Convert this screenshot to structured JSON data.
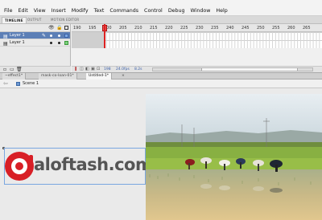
{
  "menu": [
    "File",
    "Edit",
    "View",
    "Insert",
    "Modify",
    "Text",
    "Commands",
    "Control",
    "Debug",
    "Window",
    "Help"
  ],
  "panel_tabs": [
    "TIMELINE",
    "OUTPUT",
    "MOTION EDITOR"
  ],
  "timeline": {
    "header_icons": [
      "eye-icon",
      "lock-icon",
      "outline-icon"
    ],
    "layers": [
      {
        "name": "Layer 1",
        "selected": true
      },
      {
        "name": "Layer 1",
        "selected": false
      }
    ],
    "frame_numbers": [
      "190",
      "195",
      "200",
      "205",
      "210",
      "215",
      "220",
      "225",
      "230",
      "235",
      "240",
      "245",
      "250",
      "255",
      "260",
      "265"
    ],
    "current_frame": "198",
    "fps": "24.0",
    "fps_suffix": "fps",
    "elapsed": "8.2s"
  },
  "doc_tabs": [
    "~effect1*",
    "mask-co-loan-01*",
    "Untitled-1*"
  ],
  "active_doc_tab": 2,
  "editbar": {
    "scene": "Scene 1"
  },
  "stage": {
    "logo_text": "aloftash.com",
    "logo_color": "#d81f26",
    "photo_description": "rice-field-photo"
  },
  "colors": {
    "accent": "#5c7fb6",
    "playhead": "#dd2222",
    "selection": "#7aa6e0"
  }
}
